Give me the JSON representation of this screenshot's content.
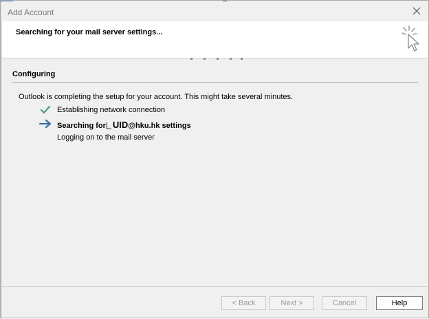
{
  "window": {
    "title": "Add Account",
    "close_label": "×"
  },
  "header": {
    "title": "Searching for your mail server settings..."
  },
  "section": {
    "title": "Configuring",
    "intro": "Outlook is completing the setup for your account. This might take several minutes."
  },
  "steps": [
    {
      "label": "Establishing network connection",
      "icon": "checkmark-icon",
      "status": "done",
      "color": "#4c9a6f"
    },
    {
      "label_prefix": "Searching for",
      "uid": "UID",
      "label_suffix": "@hku.hk settings",
      "icon": "arrow-right-icon",
      "status": "in-progress",
      "color": "#3a6fa5"
    },
    {
      "label": "Logging on to the mail server",
      "icon": "none",
      "status": "pending"
    }
  ],
  "buttons": {
    "back": "< Back",
    "next": "Next >",
    "cancel": "Cancel",
    "help": "Help"
  }
}
